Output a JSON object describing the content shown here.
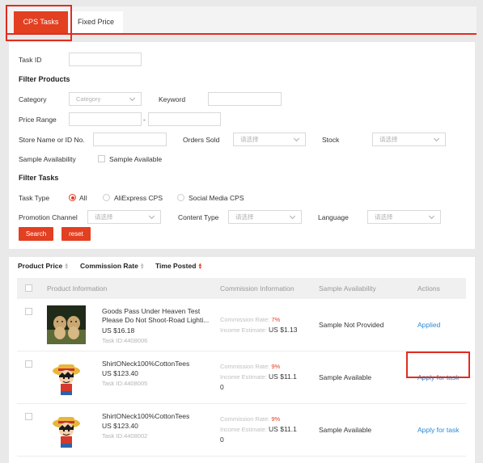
{
  "tabs": {
    "cps": "CPS Tasks",
    "fixed": "Fixed Price"
  },
  "filters": {
    "task_id_label": "Task ID",
    "filter_products_heading": "Filter Products",
    "category_label": "Category",
    "category_placeholder": "Category",
    "keyword_label": "Keyword",
    "price_range_label": "Price Range",
    "price_separator": "-",
    "store_label": "Store Name or ID No.",
    "orders_sold_label": "Orders Sold",
    "orders_sold_placeholder": "请选择",
    "stock_label": "Stock",
    "stock_placeholder": "请选择",
    "sample_availability_label": "Sample Availability",
    "sample_available_option": "Sample Available",
    "filter_tasks_heading": "Filter Tasks",
    "task_type_label": "Task Type",
    "task_type_options": [
      "All",
      "AliExpress CPS",
      "Social Media CPS"
    ],
    "promotion_channel_label": "Promotion Channel",
    "promotion_channel_placeholder": "请选择",
    "content_type_label": "Content Type",
    "content_type_placeholder": "请选择",
    "language_label": "Language",
    "language_placeholder": "请选择",
    "search_button": "Search",
    "reset_button": "reset"
  },
  "sort": {
    "product_price": "Product Price",
    "commission_rate": "Commission Rate",
    "time_posted": "Time Posted"
  },
  "table": {
    "headers": [
      "Product Information",
      "Commission Information",
      "Sample Availability",
      "Actions"
    ],
    "rows": [
      {
        "name": "Goods Pass Under Heaven Test Please Do Not Shoot-Road Lighti...",
        "price": "US $16.18",
        "task_id": "Task ID:4408006",
        "commission_rate_label": "Commission Rate:",
        "commission_rate": "7%",
        "income_label": "Income Estimate:",
        "income": "US $1.13",
        "sample": "Sample Not Provided",
        "action": "Applied",
        "image": "dogs-photo"
      },
      {
        "name": "ShirtONeck100%CottonTees",
        "price": "US $123.40",
        "task_id": "Task ID:4408005",
        "commission_rate_label": "Commission Rate:",
        "commission_rate": "9%",
        "income_label": "Income Estimate:",
        "income": "US $11.1",
        "income_wrap": "0",
        "sample": "Sample Available",
        "action": "Apply for task",
        "image": "cartoon-character"
      },
      {
        "name": "ShirtONeck100%CottonTees",
        "price": "US $123.40",
        "task_id": "Task ID:4408002",
        "commission_rate_label": "Commission Rate:",
        "commission_rate": "9%",
        "income_label": "Income Estimate:",
        "income": "US $11.1",
        "income_wrap": "0",
        "sample": "Sample Available",
        "action": "Apply for task",
        "image": "cartoon-character"
      }
    ]
  },
  "colors": {
    "accent": "#e33f21",
    "link": "#2a8ad4"
  }
}
